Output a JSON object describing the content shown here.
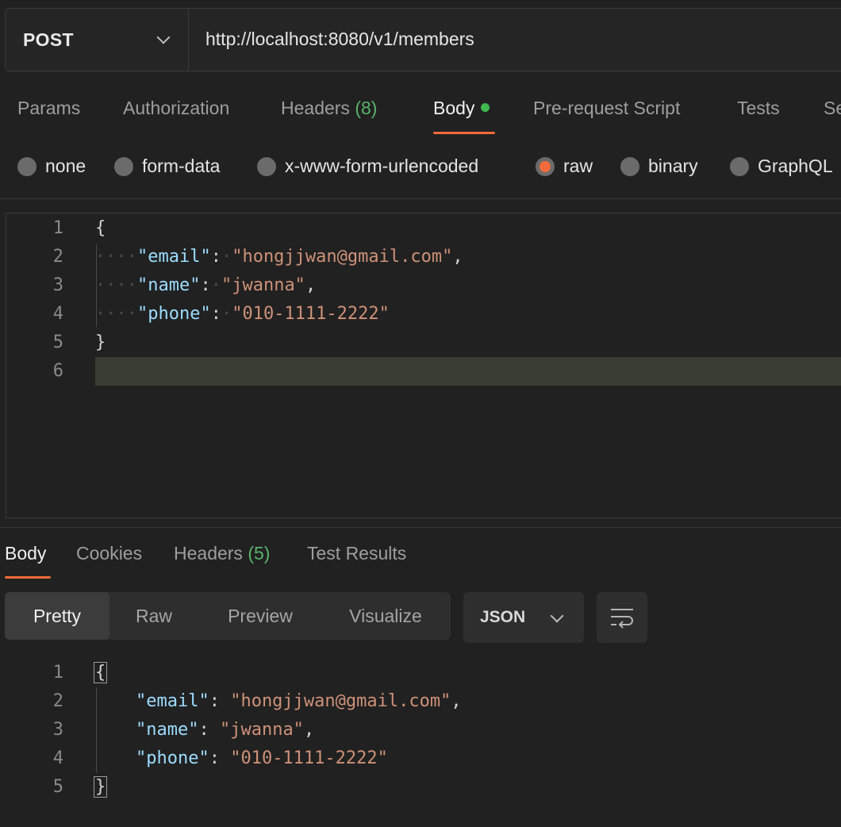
{
  "request": {
    "method": "POST",
    "url": "http://localhost:8080/v1/members"
  },
  "request_tabs": {
    "params": "Params",
    "authorization": "Authorization",
    "headers": "Headers",
    "headers_count": "(8)",
    "body": "Body",
    "pre_request": "Pre-request Script",
    "tests": "Tests",
    "settings_partial": "Se"
  },
  "body_types": {
    "none": "none",
    "form_data": "form-data",
    "urlencoded": "x-www-form-urlencoded",
    "raw": "raw",
    "binary": "binary",
    "graphql": "GraphQL",
    "selected": "raw"
  },
  "editor": {
    "line_numbers": [
      "1",
      "2",
      "3",
      "4",
      "5",
      "6"
    ],
    "open_brace": "{",
    "close_brace": "}",
    "fields": [
      {
        "key": "\"email\"",
        "value": "\"hongjjwan@gmail.com\"",
        "comma": ","
      },
      {
        "key": "\"name\"",
        "value": "\"jwanna\"",
        "comma": ","
      },
      {
        "key": "\"phone\"",
        "value": "\"010-1111-2222\"",
        "comma": ""
      }
    ],
    "indent_dots": "····"
  },
  "response_tabs": {
    "body": "Body",
    "cookies": "Cookies",
    "headers": "Headers",
    "headers_count": "(5)",
    "test_results": "Test Results"
  },
  "view_modes": {
    "pretty": "Pretty",
    "raw": "Raw",
    "preview": "Preview",
    "visualize": "Visualize",
    "format": "JSON"
  },
  "response": {
    "line_numbers": [
      "1",
      "2",
      "3",
      "4",
      "5"
    ],
    "open_brace": "{",
    "close_brace": "}",
    "fields": [
      {
        "key": "\"email\"",
        "value": "\"hongjjwan@gmail.com\"",
        "comma": ","
      },
      {
        "key": "\"name\"",
        "value": "\"jwanna\"",
        "comma": ","
      },
      {
        "key": "\"phone\"",
        "value": "\"010-1111-2222\"",
        "comma": ""
      }
    ]
  },
  "colors": {
    "accent": "#f26b3a",
    "status_green": "#3fb950",
    "json_key": "#9cdcfe",
    "json_string": "#ce9178"
  }
}
